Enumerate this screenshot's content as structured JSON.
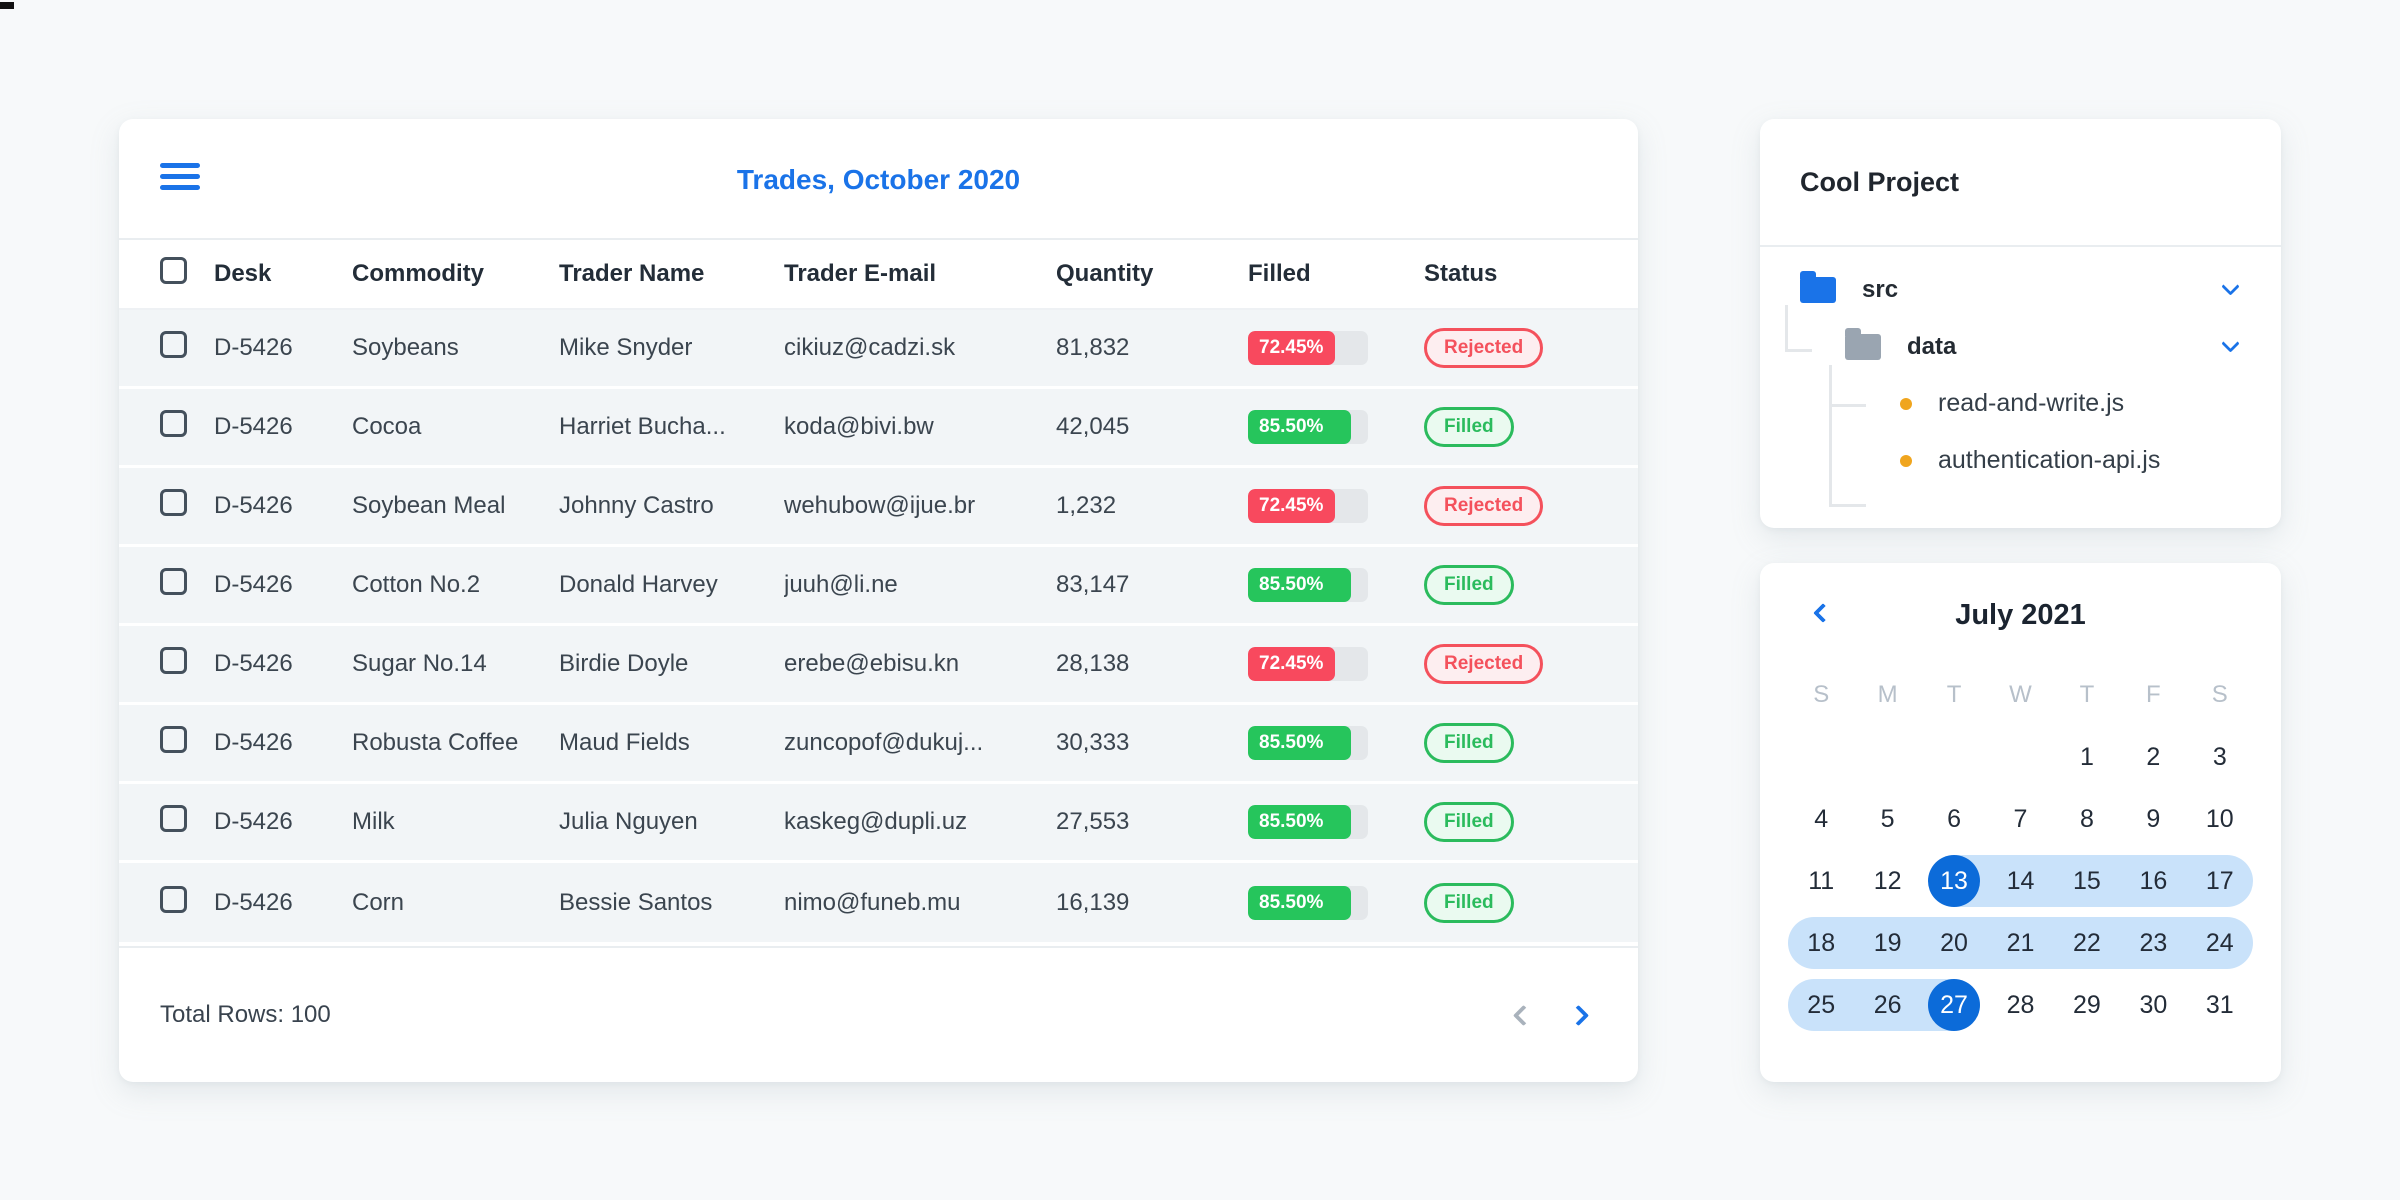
{
  "colors": {
    "page_bg": "#f7f9fa",
    "accent": "#1a73e8",
    "red": "#f8495e",
    "green": "#26c55c",
    "row_bg": "#f2f5f7",
    "track": "#e4e7ea",
    "pill_red": "#f4515c",
    "pill_red_bg": "#fdeef0",
    "pill_green": "#2bbb5d",
    "pill_green_bg": "#eafaf0",
    "band": "#c9e2fa",
    "selected": "#0c6bd9",
    "orange": "#f0a51e"
  },
  "trades_card": {
    "title": "Trades, October 2020",
    "columns": [
      "Desk",
      "Commodity",
      "Trader Name",
      "Trader E-mail",
      "Quantity",
      "Filled",
      "Status"
    ],
    "rows": [
      {
        "desk": "D-5426",
        "commodity": "Soybeans",
        "trader": "Mike Snyder",
        "email": "cikiuz@cadzi.sk",
        "quantity": "81,832",
        "filled_pct": "72.45%",
        "filled_value": 72.45,
        "status": "Rejected"
      },
      {
        "desk": "D-5426",
        "commodity": "Cocoa",
        "trader": "Harriet Bucha...",
        "email": "koda@bivi.bw",
        "quantity": "42,045",
        "filled_pct": "85.50%",
        "filled_value": 85.5,
        "status": "Filled"
      },
      {
        "desk": "D-5426",
        "commodity": "Soybean Meal",
        "trader": "Johnny Castro",
        "email": "wehubow@ijue.br",
        "quantity": "1,232",
        "filled_pct": "72.45%",
        "filled_value": 72.45,
        "status": "Rejected"
      },
      {
        "desk": "D-5426",
        "commodity": "Cotton No.2",
        "trader": "Donald Harvey",
        "email": "juuh@li.ne",
        "quantity": "83,147",
        "filled_pct": "85.50%",
        "filled_value": 85.5,
        "status": "Filled"
      },
      {
        "desk": "D-5426",
        "commodity": "Sugar No.14",
        "trader": "Birdie Doyle",
        "email": "erebe@ebisu.kn",
        "quantity": "28,138",
        "filled_pct": "72.45%",
        "filled_value": 72.45,
        "status": "Rejected"
      },
      {
        "desk": "D-5426",
        "commodity": "Robusta Coffee",
        "trader": "Maud Fields",
        "email": "zuncopof@dukuj...",
        "quantity": "30,333",
        "filled_pct": "85.50%",
        "filled_value": 85.5,
        "status": "Filled"
      },
      {
        "desk": "D-5426",
        "commodity": "Milk",
        "trader": "Julia Nguyen",
        "email": "kaskeg@dupli.uz",
        "quantity": "27,553",
        "filled_pct": "85.50%",
        "filled_value": 85.5,
        "status": "Filled"
      },
      {
        "desk": "D-5426",
        "commodity": "Corn",
        "trader": "Bessie Santos",
        "email": "nimo@funeb.mu",
        "quantity": "16,139",
        "filled_pct": "85.50%",
        "filled_value": 85.5,
        "status": "Filled"
      }
    ],
    "footer": {
      "total_label": "Total Rows: 100"
    }
  },
  "project_card": {
    "title": "Cool Project",
    "tree": [
      {
        "type": "folder",
        "label": "src",
        "expanded": true
      },
      {
        "type": "folder",
        "label": "data",
        "expanded": true
      },
      {
        "type": "file",
        "label": "read-and-write.js"
      },
      {
        "type": "file",
        "label": "authentication-api.js"
      }
    ]
  },
  "calendar_card": {
    "title": "July 2021",
    "weekdays": [
      "S",
      "M",
      "T",
      "W",
      "T",
      "F",
      "S"
    ],
    "weeks": [
      [
        "",
        "",
        "",
        "",
        "1",
        "2",
        "3"
      ],
      [
        "4",
        "5",
        "6",
        "7",
        "8",
        "9",
        "10"
      ],
      [
        "11",
        "12",
        "13",
        "14",
        "15",
        "16",
        "17"
      ],
      [
        "18",
        "19",
        "20",
        "21",
        "22",
        "23",
        "24"
      ],
      [
        "25",
        "26",
        "27",
        "28",
        "29",
        "30",
        "31"
      ]
    ],
    "range_start": 13,
    "range_end": 27,
    "selected_days": [
      13,
      27
    ]
  }
}
